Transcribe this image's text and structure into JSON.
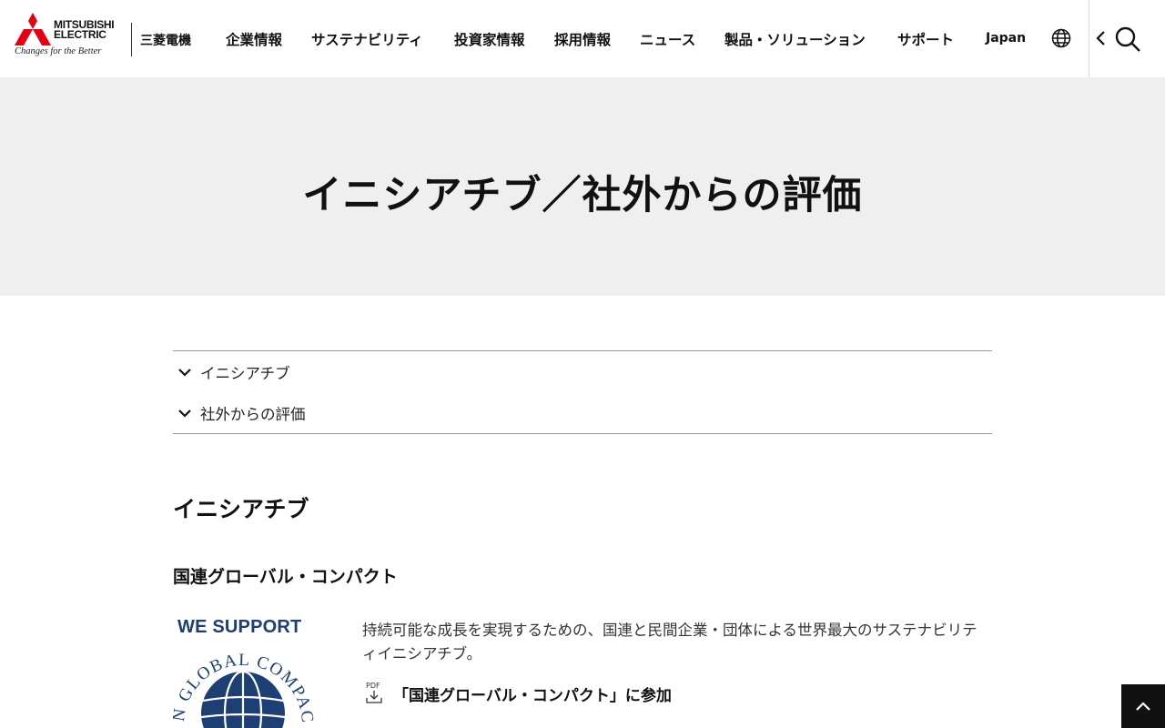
{
  "header": {
    "logo": {
      "brand_line1": "MITSUBISHI",
      "brand_line2": "ELECTRIC",
      "tagline": "Changes for the Better",
      "japanese_name": "三菱電機",
      "logo_color": "#e60012"
    },
    "nav": [
      {
        "label": "企業情報"
      },
      {
        "label": "サステナビリティ"
      },
      {
        "label": "投資家情報"
      },
      {
        "label": "採用情報"
      },
      {
        "label": "ニュース"
      },
      {
        "label": "製品・ソリューション"
      },
      {
        "label": "サポート"
      },
      {
        "label": "Japan"
      }
    ],
    "icons": [
      "globe-icon",
      "chevron-left-icon",
      "search-icon"
    ]
  },
  "hero": {
    "title": "イニシアチブ／社外からの評価",
    "background": "#efefef"
  },
  "anchors": [
    {
      "label": "イニシアチブ"
    },
    {
      "label": "社外からの評価"
    }
  ],
  "section": {
    "title": "イニシアチブ",
    "subtitle": "国連グローバル・コンパクト",
    "logo": {
      "top_text": "WE SUPPORT",
      "arc_text": "UN GLOBAL COMPACT",
      "color": "#1d3f73"
    },
    "description": "持続可能な成長を実現するための、国連と民間企業・団体による世界最大のサステナビリティイニシアチブ。",
    "pdf_link": {
      "icon_label": "PDF",
      "text": "「国連グローバル・コンパクト」に参加"
    }
  },
  "back_to_top": {
    "icon": "chevron-up-icon",
    "background": "#111111"
  }
}
